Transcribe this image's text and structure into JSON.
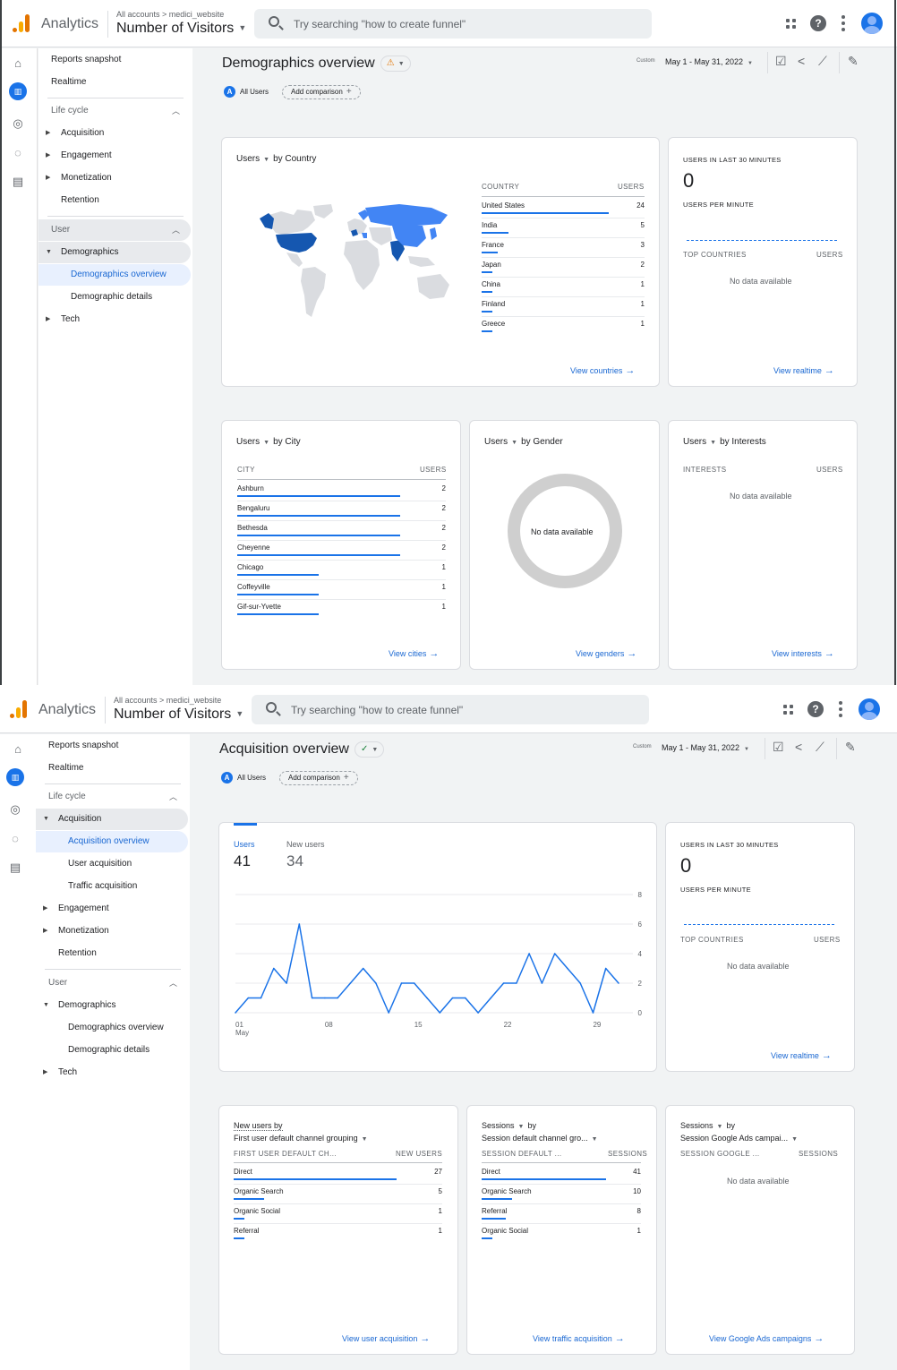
{
  "topbar": {
    "app_name": "Analytics",
    "breadcrumb": "All accounts > medici_website",
    "property": "Number of Visitors",
    "search_placeholder": "Try searching \"how to create funnel\""
  },
  "nav_common": {
    "reports_snapshot": "Reports snapshot",
    "realtime": "Realtime",
    "life_cycle": "Life cycle",
    "acquisition": "Acquisition",
    "engagement": "Engagement",
    "monetization": "Monetization",
    "retention": "Retention",
    "user": "User",
    "demographics": "Demographics",
    "demographics_overview": "Demographics overview",
    "demographic_details": "Demographic details",
    "tech": "Tech",
    "acquisition_overview": "Acquisition overview",
    "user_acquisition": "User acquisition",
    "traffic_acquisition": "Traffic acquisition"
  },
  "header_common": {
    "all_users_chip": "All Users",
    "all_users_letter": "A",
    "add_comparison": "Add comparison",
    "date_label": "Custom",
    "date_range": "May 1 - May 31, 2022"
  },
  "shot1": {
    "page_title": "Demographics overview",
    "country_card": {
      "title_metric": "Users",
      "title_dim": "by Country",
      "col_dim": "COUNTRY",
      "col_metric": "USERS",
      "rows": [
        {
          "label": "United States",
          "value": "24"
        },
        {
          "label": "India",
          "value": "5"
        },
        {
          "label": "France",
          "value": "3"
        },
        {
          "label": "Japan",
          "value": "2"
        },
        {
          "label": "China",
          "value": "1"
        },
        {
          "label": "Finland",
          "value": "1"
        },
        {
          "label": "Greece",
          "value": "1"
        }
      ],
      "link": "View countries"
    },
    "realtime_card": {
      "heading": "USERS IN LAST 30 MINUTES",
      "count": "0",
      "per_minute": "USERS PER MINUTE",
      "col_dim": "TOP COUNTRIES",
      "col_metric": "USERS",
      "nodata": "No data available",
      "link": "View realtime"
    },
    "city_card": {
      "title_metric": "Users",
      "title_dim": "by City",
      "col_dim": "CITY",
      "col_metric": "USERS",
      "rows": [
        {
          "label": "Ashburn",
          "value": "2"
        },
        {
          "label": "Bengaluru",
          "value": "2"
        },
        {
          "label": "Bethesda",
          "value": "2"
        },
        {
          "label": "Cheyenne",
          "value": "2"
        },
        {
          "label": "Chicago",
          "value": "1"
        },
        {
          "label": "Coffeyville",
          "value": "1"
        },
        {
          "label": "Gif-sur-Yvette",
          "value": "1"
        }
      ],
      "link": "View cities"
    },
    "gender_card": {
      "title_metric": "Users",
      "title_dim": "by Gender",
      "nodata": "No data available",
      "link": "View genders"
    },
    "interests_card": {
      "title_metric": "Users",
      "title_dim": "by Interests",
      "col_dim": "INTERESTS",
      "col_metric": "USERS",
      "nodata": "No data available",
      "link": "View interests"
    }
  },
  "shot2": {
    "page_title": "Acquisition overview",
    "users_card": {
      "tab_users": "Users",
      "tab_users_value": "41",
      "tab_new_users": "New users",
      "tab_new_users_value": "34"
    },
    "realtime_card": {
      "heading": "USERS IN LAST 30 MINUTES",
      "count": "0",
      "per_minute": "USERS PER MINUTE",
      "col_dim": "TOP COUNTRIES",
      "col_metric": "USERS",
      "nodata": "No data available",
      "link": "View realtime"
    },
    "new_users_card": {
      "title_line1": "New users by",
      "title_line2": "First user default channel grouping",
      "col_dim": "FIRST USER DEFAULT CH...",
      "col_metric": "NEW USERS",
      "rows": [
        {
          "label": "Direct",
          "value": "27"
        },
        {
          "label": "Organic Search",
          "value": "5"
        },
        {
          "label": "Organic Social",
          "value": "1"
        },
        {
          "label": "Referral",
          "value": "1"
        }
      ],
      "link": "View user acquisition"
    },
    "sessions_card": {
      "title_line1": "Sessions",
      "title_line1b": "by",
      "title_line2": "Session default channel gro...",
      "col_dim": "SESSION DEFAULT ...",
      "col_metric": "SESSIONS",
      "rows": [
        {
          "label": "Direct",
          "value": "41"
        },
        {
          "label": "Organic Search",
          "value": "10"
        },
        {
          "label": "Referral",
          "value": "8"
        },
        {
          "label": "Organic Social",
          "value": "1"
        }
      ],
      "link": "View traffic acquisition"
    },
    "ads_card": {
      "title_line1": "Sessions",
      "title_line1b": "by",
      "title_line2": "Session Google Ads campai...",
      "col_dim": "SESSION GOOGLE ...",
      "col_metric": "SESSIONS",
      "nodata": "No data available",
      "link": "View Google Ads campaigns"
    }
  },
  "chart_data": {
    "type": "line",
    "title": "",
    "xlabel": "",
    "ylabel": "",
    "x": [
      "01",
      "02",
      "03",
      "04",
      "05",
      "06",
      "07",
      "08",
      "09",
      "10",
      "11",
      "12",
      "13",
      "14",
      "15",
      "16",
      "17",
      "18",
      "19",
      "20",
      "21",
      "22",
      "23",
      "24",
      "25",
      "26",
      "27",
      "28",
      "29",
      "30",
      "31"
    ],
    "x_tick_labels": [
      "01 May",
      "08",
      "15",
      "22",
      "29"
    ],
    "y_tick_labels": [
      "0",
      "2",
      "4",
      "6",
      "8"
    ],
    "ylim": [
      0,
      8
    ],
    "series": [
      {
        "name": "Users",
        "values": [
          0,
          1,
          1,
          3,
          2,
          6,
          1,
          1,
          1,
          2,
          3,
          2,
          0,
          2,
          2,
          1,
          0,
          1,
          1,
          0,
          1,
          2,
          2,
          4,
          2,
          4,
          3,
          2,
          0,
          3,
          2
        ]
      }
    ],
    "grid": true,
    "line_color": "#1a73e8"
  },
  "colors": {
    "accent": "#1a73e8",
    "map_dark": "#1557b0",
    "map_mid": "#4285f4",
    "map_gray": "#dadce0",
    "donut_gray": "#cfcfcf"
  }
}
